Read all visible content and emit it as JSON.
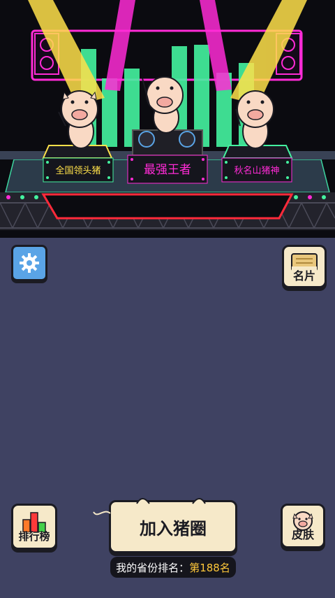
{
  "stage": {
    "left_podium_label": "全国领头猪",
    "center_podium_label": "最强王者",
    "right_podium_label": "秋名山猪神"
  },
  "buttons": {
    "card_label": "名片",
    "leaderboard_label": "排行榜",
    "join_label": "加入猪圈",
    "skin_label": "皮肤"
  },
  "rank": {
    "prefix": "我的省份排名：",
    "value": "第188名"
  },
  "colors": {
    "background": "#3f4262",
    "stage_bg": "#0b0b10",
    "neon_magenta": "#ff2bd6",
    "neon_yellow": "#ffe14a",
    "equalizer_green": "#44f3a0",
    "button_cream": "#f6e9c9",
    "rank_highlight": "#ffc83a"
  },
  "icons": {
    "settings": "gear-icon",
    "card": "card-icon",
    "leaderboard": "bar-chart-icon",
    "skin": "pig-face-icon"
  }
}
